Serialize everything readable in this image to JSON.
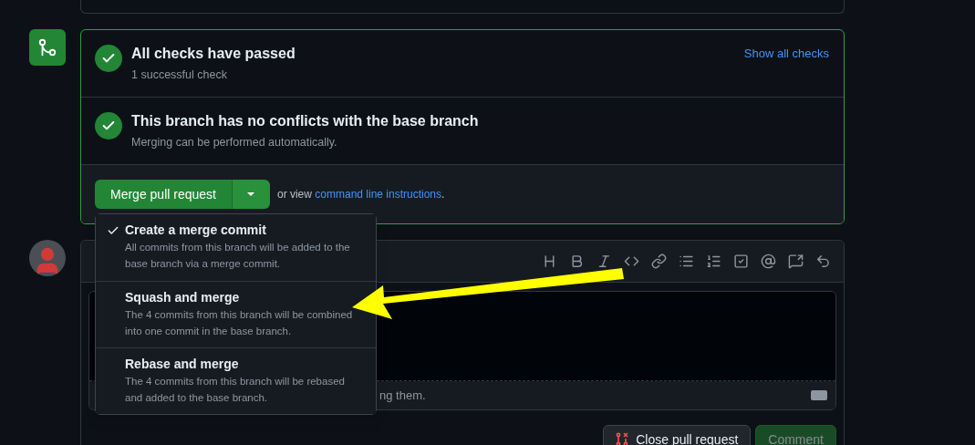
{
  "checks": [
    {
      "title": "All checks have passed",
      "subtitle": "1 successful check",
      "link": "Show all checks",
      "passed": true
    },
    {
      "title": "This branch has no conflicts with the base branch",
      "subtitle": "Merging can be performed automatically.",
      "passed": true
    }
  ],
  "merge": {
    "button": "Merge pull request",
    "hint_prefix": "or view",
    "hint_link": "command line instructions",
    "hint_suffix": "."
  },
  "merge_menu": [
    {
      "title": "Create a merge commit",
      "description": "All commits from this branch will be added to the base branch via a merge commit.",
      "selected": true
    },
    {
      "title": "Squash and merge",
      "description": "The 4 commits from this branch will be combined into one commit in the base branch.",
      "selected": false
    },
    {
      "title": "Rebase and merge",
      "description": "The 4 commits from this branch will be rebased and added to the base branch.",
      "selected": false
    }
  ],
  "comment": {
    "footer_hint": "ng them.",
    "buttons": [
      {
        "label": "Close pull request",
        "kind": "close",
        "disabled": false
      },
      {
        "label": "Comment",
        "kind": "submit",
        "disabled": true
      }
    ]
  }
}
